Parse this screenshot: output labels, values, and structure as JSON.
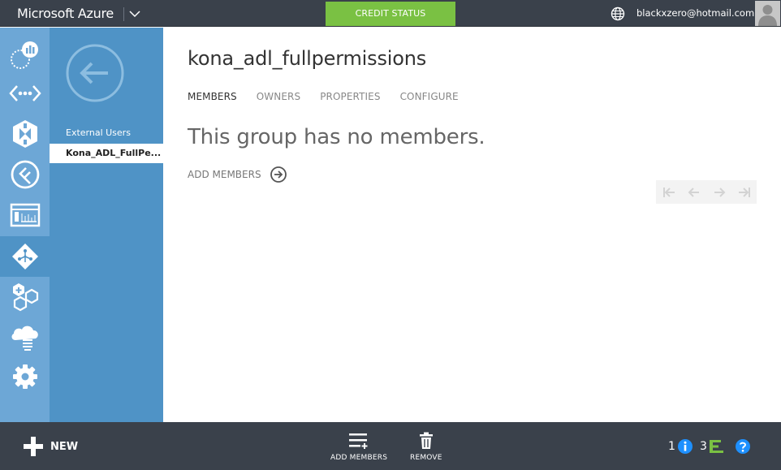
{
  "topbar": {
    "brand": "Microsoft Azure",
    "credit_status": "CREDIT STATUS",
    "user_email": "blackxzero@hotmail.com"
  },
  "nav": {
    "icons": [
      "hdinsight-icon",
      "virtual-network-icon",
      "biztalk-icon",
      "remote-app-icon",
      "media-services-icon",
      "active-directory-icon",
      "marketplace-icon",
      "storsimple-icon",
      "settings-icon"
    ],
    "active_index": 5
  },
  "subnav": {
    "items": [
      {
        "label": "External Users",
        "selected": false
      },
      {
        "label": "Kona_ADL_FullPe...",
        "selected": true
      }
    ]
  },
  "main": {
    "title": "kona_adl_fullpermissions",
    "tabs": [
      {
        "label": "MEMBERS",
        "active": true
      },
      {
        "label": "OWNERS",
        "active": false
      },
      {
        "label": "PROPERTIES",
        "active": false
      },
      {
        "label": "CONFIGURE",
        "active": false
      }
    ],
    "empty_message": "This group has no members.",
    "add_members_label": "ADD MEMBERS"
  },
  "bottombar": {
    "new_label": "NEW",
    "commands": [
      {
        "label": "ADD MEMBERS",
        "icon": "add-list-icon"
      },
      {
        "label": "REMOVE",
        "icon": "trash-icon"
      }
    ],
    "info_count": "1",
    "progress_count": "3"
  },
  "colors": {
    "topbar": "#3a414b",
    "credit": "#7ac143",
    "nav": "#6da7d6",
    "subnav": "#4f93c6",
    "accent_info": "#1e90ff",
    "progress_green": "#7ac143"
  }
}
